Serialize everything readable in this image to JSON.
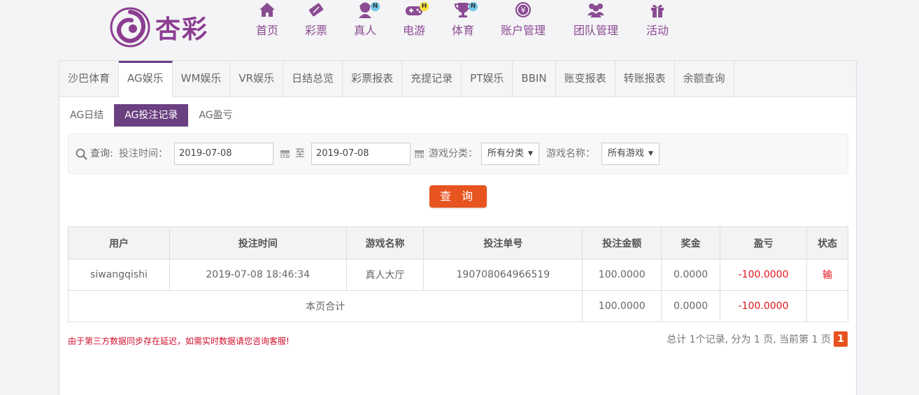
{
  "brand": {
    "name": "杏彩",
    "color": "#8b3d92"
  },
  "nav": [
    {
      "label": "首页",
      "icon": "home-icon"
    },
    {
      "label": "彩票",
      "icon": "ticket-icon"
    },
    {
      "label": "真人",
      "icon": "dealer-icon",
      "badge": "N"
    },
    {
      "label": "电游",
      "icon": "gamepad-icon",
      "badge": "H"
    },
    {
      "label": "体育",
      "icon": "trophy-icon",
      "badge": "N"
    },
    {
      "label": "账户管理",
      "icon": "yen-icon"
    },
    {
      "label": "团队管理",
      "icon": "team-icon"
    },
    {
      "label": "活动",
      "icon": "gift-icon"
    }
  ],
  "tabs": [
    "沙巴体育",
    "AG娱乐",
    "WM娱乐",
    "VR娱乐",
    "日结总览",
    "彩票报表",
    "充提记录",
    "PT娱乐",
    "BBIN",
    "账变报表",
    "转账报表",
    "余额查询"
  ],
  "active_tab": "AG娱乐",
  "subtabs": [
    "AG日结",
    "AG投注记录",
    "AG盈亏"
  ],
  "active_subtab": "AG投注记录",
  "search": {
    "query_label": "查询:",
    "bet_time_label": "投注时间：",
    "start_date": "2019-07-08",
    "to_label": "至",
    "end_date": "2019-07-08",
    "category_label": "游戏分类：",
    "category_value": "所有分类",
    "game_name_label": "游戏名称：",
    "game_name_value": "所有游戏",
    "button": "查 询"
  },
  "table": {
    "headers": [
      "用户",
      "投注时间",
      "游戏名称",
      "投注单号",
      "投注金额",
      "奖金",
      "盈亏",
      "状态"
    ],
    "rows": [
      [
        "siwangqishi",
        "2019-07-08 18:46:34",
        "真人大厅",
        "190708064966519",
        "100.0000",
        "0.0000",
        "-100.0000",
        "输"
      ]
    ],
    "total": {
      "label": "本页合计",
      "amount": "100.0000",
      "bonus": "0.0000",
      "profit": "-100.0000"
    }
  },
  "note": "由于第三方数据同步存在延迟，如需实时数据请您咨询客服!",
  "pager": {
    "text": "总计 1个记录, 分为 1 页, 当前第 1 页",
    "current": "1"
  },
  "colors": {
    "accent": "#6a4080",
    "button": "#e7541f",
    "negative": "#e0141e",
    "nav": "#8a4b92"
  }
}
